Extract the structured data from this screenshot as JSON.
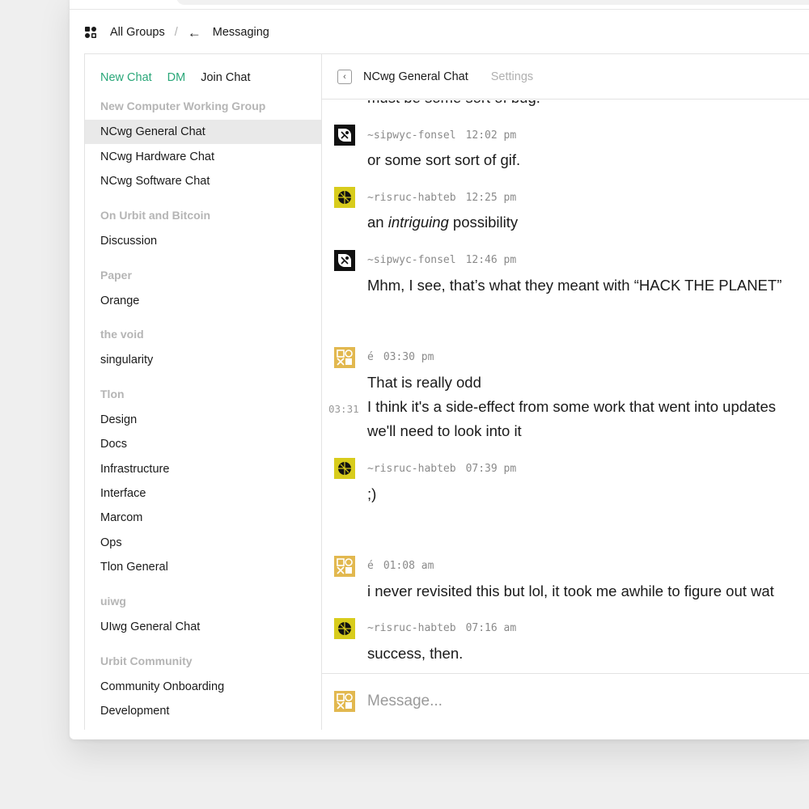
{
  "breadcrumb": {
    "all_groups": "All Groups",
    "separator": "/",
    "back_arrow": "←",
    "current": "Messaging"
  },
  "sidebar": {
    "actions": {
      "new_chat": "New Chat",
      "dm": "DM",
      "join_chat": "Join Chat"
    },
    "groups": [
      {
        "name": "New Computer Working Group",
        "channels": [
          "NCwg General Chat",
          "NCwg Hardware Chat",
          "NCwg Software Chat"
        ]
      },
      {
        "name": "On Urbit and Bitcoin",
        "channels": [
          "Discussion"
        ]
      },
      {
        "name": "Paper",
        "channels": [
          "Orange"
        ]
      },
      {
        "name": "the void",
        "channels": [
          "singularity"
        ]
      },
      {
        "name": "Tlon",
        "channels": [
          "Design",
          "Docs",
          "Infrastructure",
          "Interface",
          "Marcom",
          "Ops",
          "Tlon General"
        ]
      },
      {
        "name": "uiwg",
        "channels": [
          "UIwg General Chat"
        ]
      },
      {
        "name": "Urbit Community",
        "channels": [
          "Community Onboarding",
          "Development"
        ]
      }
    ],
    "active_channel": "NCwg General Chat"
  },
  "chat": {
    "back_icon": "‹",
    "title": "NCwg General Chat",
    "settings": "Settings",
    "partial_top": "must be some sort of bug.",
    "messages": [
      {
        "author": "~sipwyc-fonsel",
        "time": "12:02 pm",
        "avatar": "sigil-black",
        "lines": [
          "or some sort sort of gif."
        ]
      },
      {
        "author": "~risruc-habteb",
        "time": "12:25 pm",
        "avatar": "sigil-yellow",
        "lines": [
          "an intriguing possibility"
        ]
      },
      {
        "author": "~sipwyc-fonsel",
        "time": "12:46 pm",
        "avatar": "sigil-black",
        "lines": [
          "Mhm, I see, that’s what they meant with “HACK THE PLANET”"
        ]
      },
      {
        "author": "é",
        "time": "03:30 pm",
        "avatar": "sigil-gold",
        "lines": [
          "That is really odd"
        ]
      },
      {
        "side_time": "03:31",
        "lines": [
          "I think it's a side-effect from some work that went into updates",
          "we'll need to look into it"
        ]
      },
      {
        "author": "~risruc-habteb",
        "time": "07:39 pm",
        "avatar": "sigil-yellow",
        "lines": [
          ";)"
        ]
      },
      {
        "author": "é",
        "time": "01:08 am",
        "avatar": "sigil-gold",
        "lines": [
          "i never revisited this but lol, it took me awhile to figure out wat"
        ]
      },
      {
        "author": "~risruc-habteb",
        "time": "07:16 am",
        "avatar": "sigil-yellow",
        "lines": [
          "success, then."
        ]
      }
    ],
    "composer_placeholder": "Message..."
  },
  "colors": {
    "accent_green": "#2aa779",
    "sigil_gold": "#e2b84f",
    "sigil_yellow": "#d8cc1c",
    "muted_text": "#b5b5b5"
  }
}
